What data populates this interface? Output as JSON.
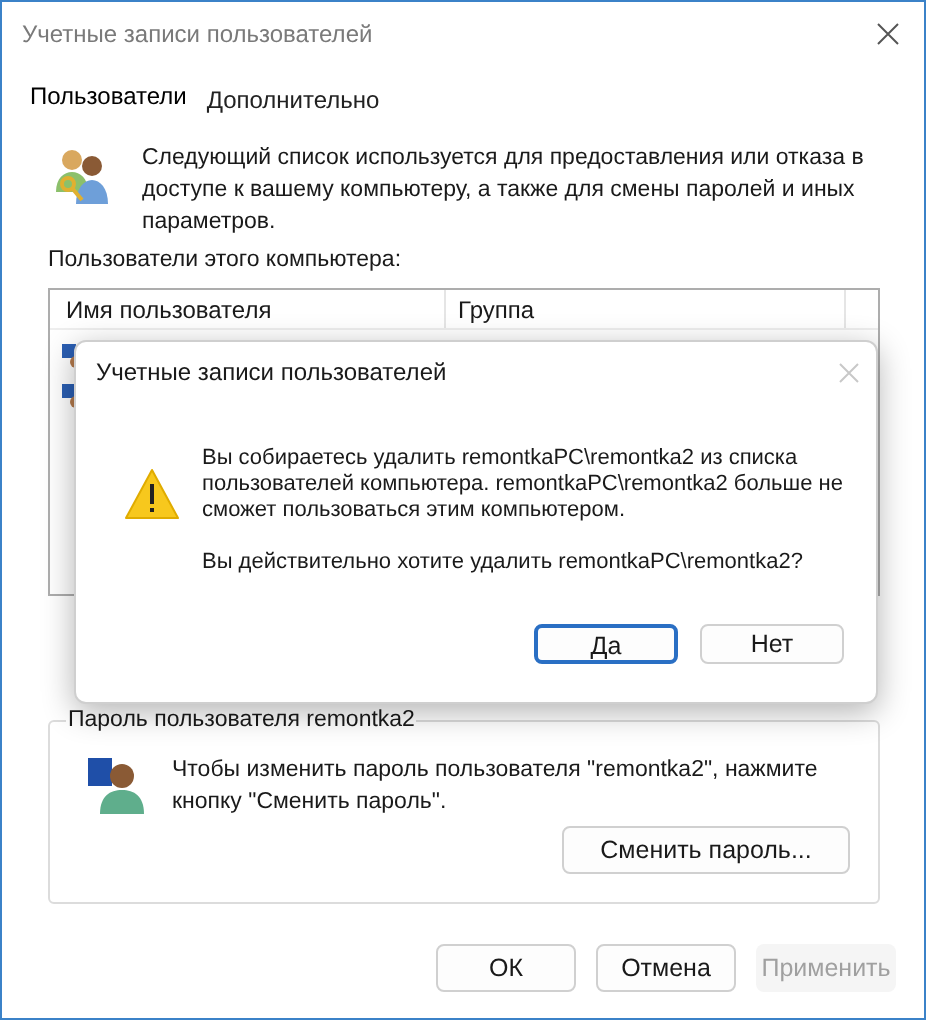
{
  "window": {
    "title": "Учетные записи пользователей"
  },
  "tabs": [
    {
      "label": "Пользователи",
      "selected": true
    },
    {
      "label": "Дополнительно",
      "selected": false
    }
  ],
  "description": "Следующий список используется для предоставления или отказа в доступе к вашему компьютеру, а также для смены паролей и иных параметров.",
  "users_label": "Пользователи этого компьютера:",
  "users_table": {
    "columns": [
      "Имя пользователя",
      "Группа"
    ]
  },
  "password_group": {
    "legend": "Пароль пользователя remontka2",
    "text": "Чтобы изменить пароль пользователя \"remontka2\", нажмите кнопку \"Сменить пароль\".",
    "button": "Сменить пароль..."
  },
  "buttons": [
    {
      "label": "ОК",
      "disabled": false
    },
    {
      "label": "Отмена",
      "disabled": false
    },
    {
      "label": "Применить",
      "disabled": true
    }
  ],
  "dialog": {
    "title": "Учетные записи пользователей",
    "message": [
      "Вы собираетесь удалить remontkaPC\\remontka2 из списка пользователей компьютера. remontkaPC\\remontka2 больше не сможет пользоваться этим компьютером.",
      "Вы действительно хотите удалить remontkaPC\\remontka2?"
    ],
    "buttons": [
      {
        "label": "Да",
        "selected": true
      },
      {
        "label": "Нет",
        "selected": false
      }
    ]
  }
}
